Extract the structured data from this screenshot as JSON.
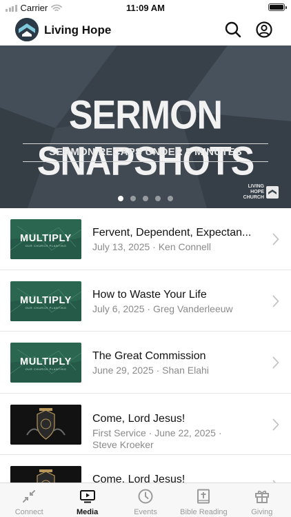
{
  "status_bar": {
    "carrier": "Carrier",
    "time": "11:09 AM"
  },
  "header": {
    "title": "Living Hope"
  },
  "hero": {
    "title": "SERMON SNAPSHOTS",
    "subtitle": "SERMON RECAPS UNDER 5 MINUTES",
    "brand_line1": "LIVING",
    "brand_line2": "HOPE",
    "brand_line3": "CHURCH",
    "page_count": 5,
    "active_page": 1
  },
  "media": [
    {
      "thumb": "MULTIPLY",
      "thumb_sub": "OUR CHURCH PLANTING",
      "title": "Fervent, Dependent, Expectan...",
      "meta": "July 13, 2025 ·  Ken Connell"
    },
    {
      "thumb": "MULTIPLY",
      "thumb_sub": "OUR CHURCH PLANTING",
      "title": "How to Waste Your Life",
      "meta": "July 6, 2025 ·  Greg Vanderleeuw"
    },
    {
      "thumb": "MULTIPLY",
      "thumb_sub": "OUR CHURCH PLANTING",
      "title": "The Great Commission",
      "meta": "June 29, 2025 · Shan Elahi"
    },
    {
      "thumb": "",
      "title": "Come, Lord Jesus!",
      "meta_line1": "First Service · June 22, 2025 ·",
      "meta_line2": "Steve Kroeker"
    },
    {
      "thumb": "",
      "title": "Come, Lord Jesus!",
      "meta": ""
    }
  ],
  "tabs": [
    {
      "label": "Connect",
      "icon": "connect-icon"
    },
    {
      "label": "Media",
      "icon": "media-icon",
      "active": true
    },
    {
      "label": "Events",
      "icon": "clock-icon"
    },
    {
      "label": "Bible Reading",
      "icon": "bible-icon"
    },
    {
      "label": "Giving",
      "icon": "gift-icon"
    }
  ],
  "colors": {
    "accent": "#111111",
    "muted": "#8a8a8a",
    "hero_bg": "#3d464f",
    "multiply_green": "#2a6650"
  }
}
